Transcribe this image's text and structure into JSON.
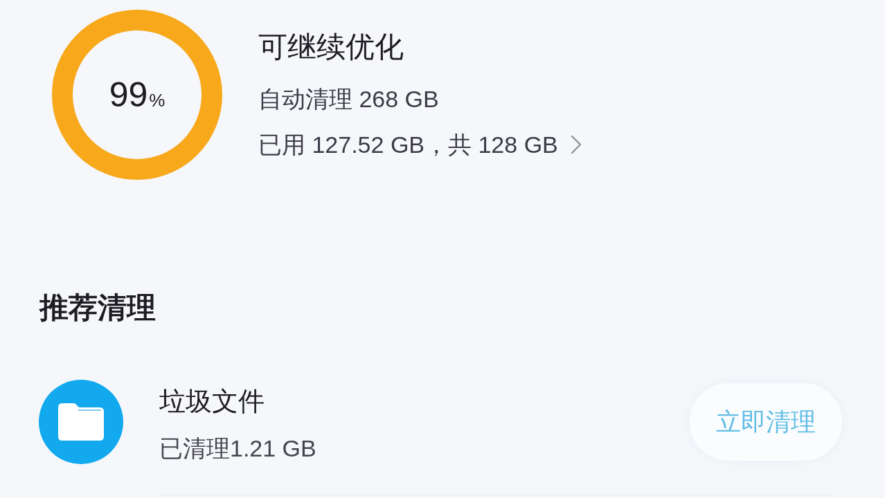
{
  "storage_summary": {
    "usage_ring": {
      "level": 0.99,
      "value": "99",
      "unit": "%"
    },
    "title": "可继续优化",
    "auto_clean": "自动清理 268 GB",
    "usage": "已用 127.52 GB，共 128 GB"
  },
  "recommended": {
    "title": "推荐清理",
    "items": [
      {
        "kind": "folder",
        "title": "垃圾文件",
        "subtitle": "已清理1.21 GB",
        "action": "立即清理"
      }
    ]
  }
}
